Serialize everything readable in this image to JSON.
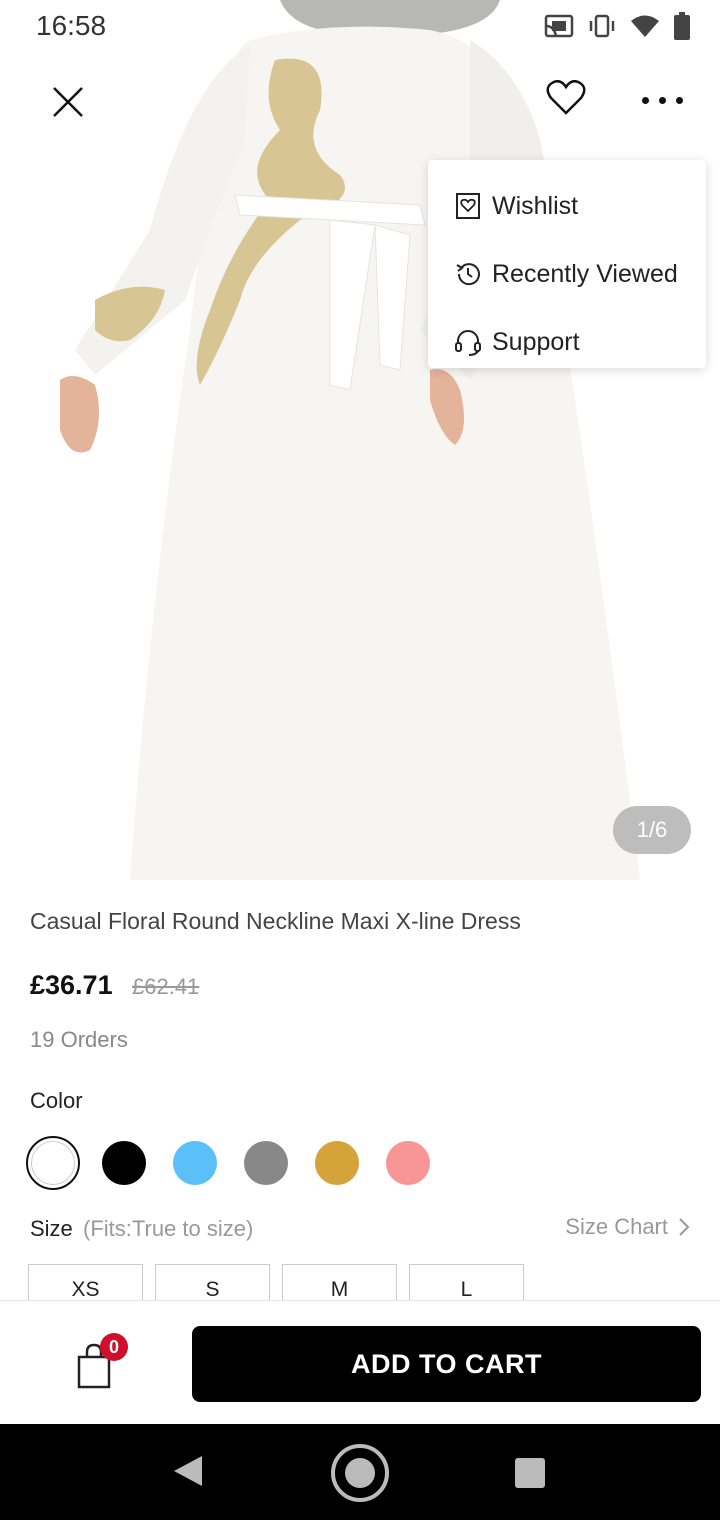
{
  "status_bar": {
    "time": "16:58"
  },
  "toolbar": {
    "close_icon": "close-icon",
    "wish_icon": "heart-icon",
    "more_icon": "more-dots-icon"
  },
  "menu": {
    "items": [
      {
        "label": "Wishlist",
        "icon": "wishlist-heart-icon"
      },
      {
        "label": "Recently Viewed",
        "icon": "history-icon"
      },
      {
        "label": "Support",
        "icon": "headset-icon"
      }
    ]
  },
  "gallery": {
    "pager": "1/6"
  },
  "product": {
    "title": "Casual Floral Round Neckline Maxi X-line Dress",
    "price": "£36.71",
    "original_price": "£62.41",
    "orders": "19 Orders"
  },
  "color": {
    "label": "Color",
    "swatches": [
      "#ffffff",
      "#000000",
      "#5bc0f8",
      "#888888",
      "#d4a43a",
      "#f89595"
    ],
    "selected_index": 0
  },
  "size": {
    "label": "Size",
    "fit": "(Fits:True to size)",
    "chart_label": "Size Chart",
    "options": [
      "XS",
      "S",
      "M",
      "L"
    ]
  },
  "bottom_bar": {
    "cart_count": "0",
    "add_to_cart": "ADD TO CART"
  }
}
